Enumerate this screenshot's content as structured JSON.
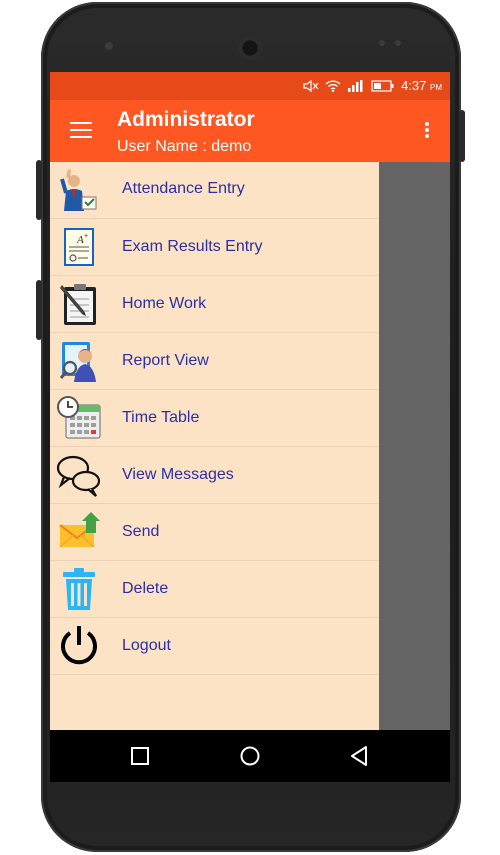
{
  "status_bar": {
    "time": "4:37",
    "ampm": "PM",
    "icons": [
      "mute-icon",
      "wifi-icon",
      "signal-icon",
      "battery-icon"
    ],
    "color": "#e64a19"
  },
  "toolbar": {
    "title": "Administrator",
    "subtitle": "User Name : demo",
    "color": "#ff5722"
  },
  "drawer": {
    "background": "#fde3c6",
    "items": [
      {
        "label": "Attendance Entry",
        "icon": "attendance-icon"
      },
      {
        "label": "Exam Results Entry",
        "icon": "exam-results-icon"
      },
      {
        "label": "Home Work",
        "icon": "homework-icon"
      },
      {
        "label": "Report View",
        "icon": "report-view-icon"
      },
      {
        "label": "Time Table",
        "icon": "timetable-icon"
      },
      {
        "label": "View Messages",
        "icon": "messages-icon"
      },
      {
        "label": "Send",
        "icon": "send-icon"
      },
      {
        "label": "Delete",
        "icon": "trash-icon"
      },
      {
        "label": "Logout",
        "icon": "power-icon"
      }
    ]
  },
  "nav_bar": {
    "buttons": [
      "recents-icon",
      "home-icon",
      "back-icon"
    ]
  }
}
